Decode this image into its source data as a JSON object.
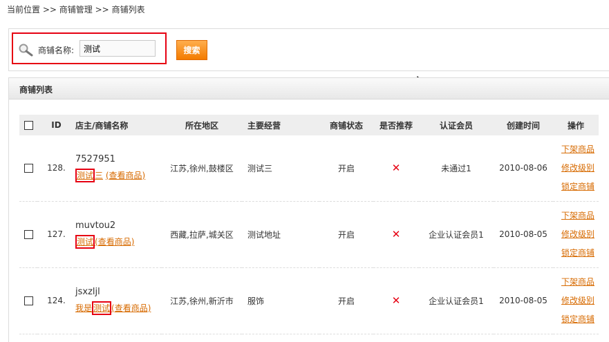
{
  "breadcrumb": {
    "items": [
      "当前位置",
      "商铺管理",
      "商铺列表"
    ],
    "sep": ">>"
  },
  "search": {
    "label": "商铺名称:",
    "value": "测试",
    "button": "搜索"
  },
  "list": {
    "title": "商铺列表",
    "headers": [
      "ID",
      "店主/商铺名称",
      "所在地区",
      "主要经营",
      "商铺状态",
      "是否推荐",
      "认证会员",
      "创建时间",
      "操作"
    ],
    "rows": [
      {
        "id": "128.",
        "owner": "7527951",
        "shop_a": "测试",
        "shop_b": "三",
        "view": "(查看商品)",
        "region": "江苏,徐州,鼓楼区",
        "business": "测试三",
        "status": "开启",
        "recommend": "✕",
        "cert": "未通过1",
        "date": "2010-08-06",
        "ops": [
          "下架商品",
          "修改级别",
          "锁定商铺"
        ]
      },
      {
        "id": "127.",
        "owner": "muvtou2",
        "shop_a": "测试",
        "shop_b": "",
        "view": "(查看商品)",
        "region": "西藏,拉萨,城关区",
        "business": "测试地址",
        "status": "开启",
        "recommend": "✕",
        "cert": "企业认证会员1",
        "date": "2010-08-05",
        "ops": [
          "下架商品",
          "修改级别",
          "锁定商铺"
        ]
      },
      {
        "id": "124.",
        "owner": "jsxzljl",
        "shop_pre": "我是",
        "shop_a": "测试",
        "shop_b": "",
        "view": "(查看商品)",
        "region": "江苏,徐州,新沂市",
        "business": "服饰",
        "status": "开启",
        "recommend": "✕",
        "cert": "企业认证会员1",
        "date": "2010-08-05",
        "ops": [
          "下架商品",
          "修改级别",
          "锁定商铺"
        ]
      }
    ]
  },
  "colors": {
    "accent": "#f37b00",
    "highlight": "#e60012",
    "link": "#d76a00"
  }
}
